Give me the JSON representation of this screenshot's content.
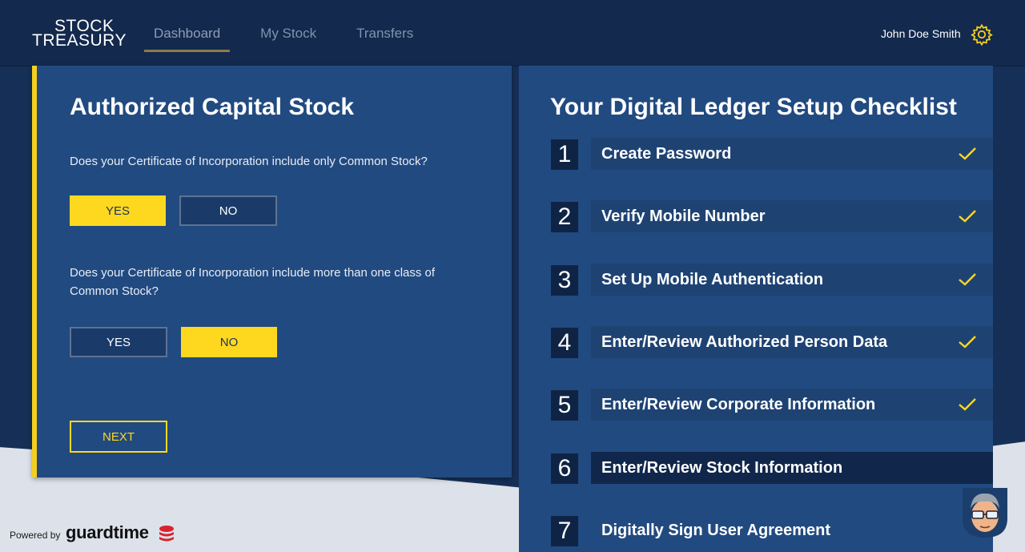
{
  "brand": {
    "line1": "STOCK",
    "line2": "TREASURY"
  },
  "nav": {
    "items": [
      {
        "label": "Dashboard",
        "active": true
      },
      {
        "label": "My Stock",
        "active": false
      },
      {
        "label": "Transfers",
        "active": false
      }
    ]
  },
  "user": {
    "name": "John Doe Smith"
  },
  "left": {
    "title": "Authorized Capital Stock",
    "q1": {
      "text": "Does your Certificate of Incorporation include only Common Stock?",
      "yes": "YES",
      "no": "NO",
      "selected": "YES"
    },
    "q2": {
      "text": "Does your Certificate of Incorporation include more than one class of Common Stock?",
      "yes": "YES",
      "no": "NO",
      "selected": "NO"
    },
    "next": "NEXT"
  },
  "checklist": {
    "title": "Your Digital Ledger Setup Checklist",
    "steps": [
      {
        "num": "1",
        "label": "Create Password",
        "done": true
      },
      {
        "num": "2",
        "label": "Verify Mobile Number",
        "done": true
      },
      {
        "num": "3",
        "label": "Set Up Mobile Authentication",
        "done": true
      },
      {
        "num": "4",
        "label": "Enter/Review Authorized Person Data",
        "done": true
      },
      {
        "num": "5",
        "label": "Enter/Review Corporate Information",
        "done": true
      },
      {
        "num": "6",
        "label": "Enter/Review Stock Information",
        "done": false,
        "current": true
      },
      {
        "num": "7",
        "label": "Digitally Sign User Agreement",
        "done": false
      }
    ]
  },
  "footer": {
    "powered": "Powered by",
    "partner": "guardtime"
  },
  "colors": {
    "accent": "#fed81f",
    "panel": "#214a80",
    "header": "#13294d",
    "step_bar": "#1e4373",
    "step_current": "#10274b"
  },
  "icons": {
    "settings": "gear-icon",
    "check": "checkmark-icon",
    "avatar": "assistant-avatar-icon"
  }
}
